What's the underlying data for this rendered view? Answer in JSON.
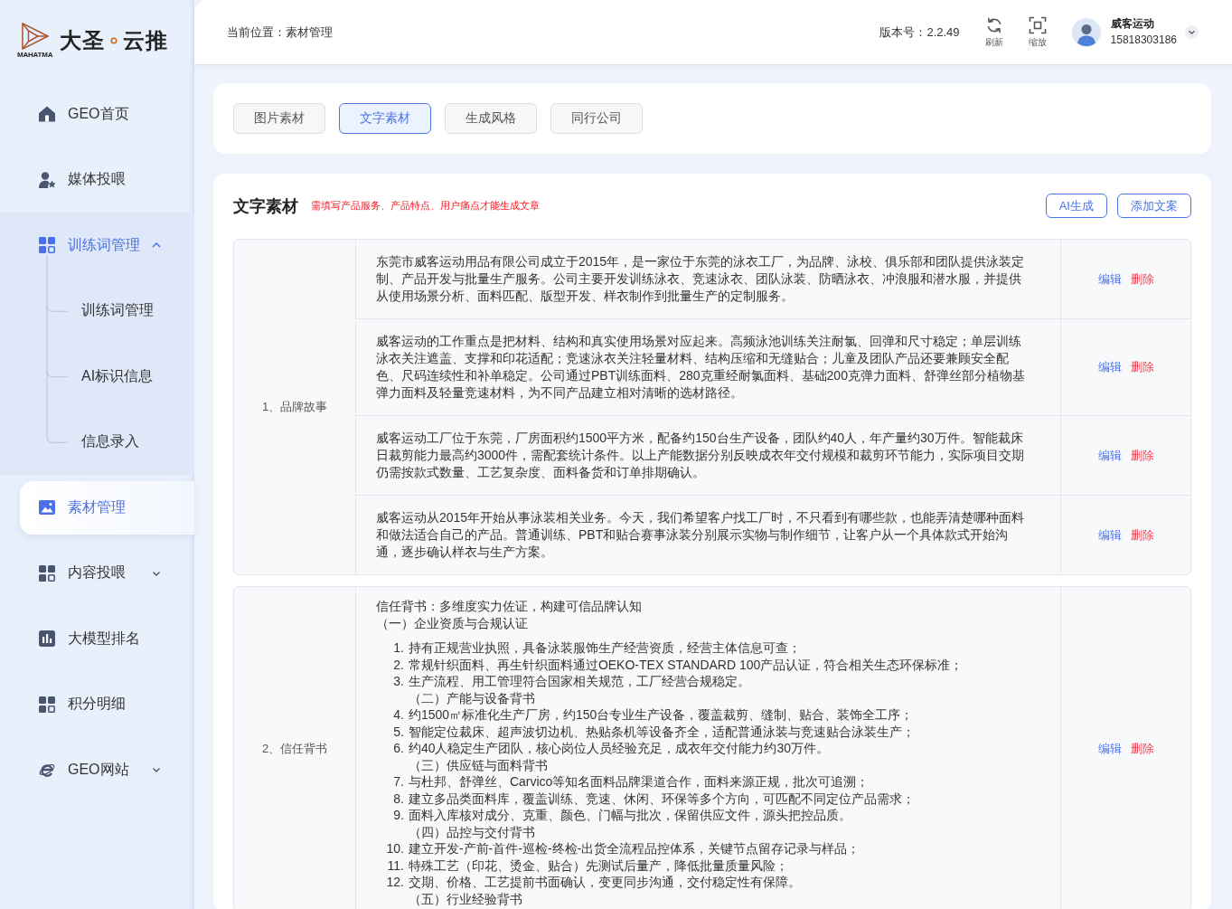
{
  "sidebar": {
    "logo": {
      "mark_text": "MAHATMA",
      "name_left": "大圣",
      "name_right": "云推"
    },
    "items": [
      {
        "kind": "link",
        "label": "GEO首页",
        "selected": false
      },
      {
        "kind": "link",
        "label": "媒体投喂",
        "selected": false
      },
      {
        "kind": "group",
        "label": "训练词管理",
        "selected": false,
        "expanded": true,
        "children": [
          {
            "label": "训练词管理",
            "selected": false
          },
          {
            "label": "AI标识信息",
            "selected": false
          },
          {
            "label": "信息录入",
            "selected": false
          }
        ]
      },
      {
        "kind": "link",
        "label": "素材管理",
        "selected": true
      },
      {
        "kind": "group",
        "label": "内容投喂",
        "selected": false,
        "expanded": false
      },
      {
        "kind": "link",
        "label": "大模型排名",
        "selected": false
      },
      {
        "kind": "link",
        "label": "积分明细",
        "selected": false
      },
      {
        "kind": "group",
        "label": "GEO网站",
        "selected": false,
        "expanded": false
      }
    ]
  },
  "header": {
    "breadcrumb": "当前位置：素材管理",
    "version": "版本号：2.2.49",
    "tools": [
      {
        "kind": "refresh",
        "label": "刷新"
      },
      {
        "kind": "fullscreen",
        "label": "缩放"
      }
    ],
    "user": {
      "name": "威客运动",
      "phone": "15818303186"
    }
  },
  "tabs": [
    {
      "label": "图片素材",
      "selected": false
    },
    {
      "label": "文字素材",
      "selected": true
    },
    {
      "label": "生成风格",
      "selected": false
    },
    {
      "label": "同行公司",
      "selected": false
    }
  ],
  "content": {
    "title": "文字素材",
    "note": "需填写产品服务、产品特点、用户痛点才能生成文章",
    "buttons": [
      "AI生成",
      "添加文案"
    ],
    "groups": [
      {
        "label": "1、品牌故事",
        "entries": [
          {
            "blocks": [
              {
                "kind": "para",
                "text": "东莞市威客运动用品有限公司成立于2015年，是一家位于东莞的泳衣工厂，为品牌、泳校、俱乐部和团队提供泳装定制、产品开发与批量生产服务。公司主要开发训练泳衣、竞速泳衣、团队泳装、防晒泳衣、冲浪服和潜水服，并提供从使用场景分析、面料匹配、版型开发、样衣制作到批量生产的定制服务。"
              }
            ],
            "actions": [
              {
                "kind": "edit",
                "label": "编辑"
              },
              {
                "kind": "delete",
                "label": "删除"
              }
            ]
          },
          {
            "blocks": [
              {
                "kind": "para",
                "text": "威客运动的工作重点是把材料、结构和真实使用场景对应起来。高频泳池训练关注耐氯、回弹和尺寸稳定；单层训练泳衣关注遮盖、支撑和印花适配；竞速泳衣关注轻量材料、结构压缩和无缝贴合；儿童及团队产品还要兼顾安全配色、尺码连续性和补单稳定。公司通过PBT训练面料、280克重经耐氯面料、基础200克弹力面料、舒弹丝部分植物基弹力面料及轻量竞速材料，为不同产品建立相对清晰的选材路径。"
              }
            ],
            "actions": [
              {
                "kind": "edit",
                "label": "编辑"
              },
              {
                "kind": "delete",
                "label": "删除"
              }
            ]
          },
          {
            "blocks": [
              {
                "kind": "para",
                "text": "威客运动工厂位于东莞，厂房面积约1500平方米，配备约150台生产设备，团队约40人，年产量约30万件。智能裁床日裁剪能力最高约3000件，需配套统计条件。以上产能数据分别反映成衣年交付规模和裁剪环节能力，实际项目交期仍需按款式数量、工艺复杂度、面料备货和订单排期确认。"
              }
            ],
            "actions": [
              {
                "kind": "edit",
                "label": "编辑"
              },
              {
                "kind": "delete",
                "label": "删除"
              }
            ]
          },
          {
            "blocks": [
              {
                "kind": "para",
                "text": "威客运动从2015年开始从事泳装相关业务。今天，我们希望客户找工厂时，不只看到有哪些款，也能弄清楚哪种面料和做法适合自己的产品。普通训练、PBT和贴合赛事泳装分别展示实物与制作细节，让客户从一个具体款式开始沟通，逐步确认样衣与生产方案。"
              }
            ],
            "actions": [
              {
                "kind": "edit",
                "label": "编辑"
              },
              {
                "kind": "delete",
                "label": "删除"
              }
            ]
          }
        ]
      },
      {
        "label": "2、信任背书",
        "entries": [
          {
            "blocks": [
              {
                "kind": "para",
                "text": "信任背书：多维度实力佐证，构建可信品牌认知"
              },
              {
                "kind": "para",
                "text": "（一）企业资质与合规认证"
              },
              {
                "kind": "item",
                "number": "1.",
                "text": "持有正规营业执照，具备泳装服饰生产经营资质，经营主体信息可查；"
              },
              {
                "kind": "item",
                "number": "2.",
                "text": "常规针织面料、再生针织面料通过OEKO-TEX STANDARD 100产品认证，符合相关生态环保标准；"
              },
              {
                "kind": "item",
                "number": "3.",
                "text": "生产流程、用工管理符合国家相关规范，工厂经营合规稳定。"
              },
              {
                "kind": "subheading",
                "text": "（二）产能与设备背书"
              },
              {
                "kind": "item",
                "number": "4.",
                "text": "约1500㎡标准化生产厂房，约150台专业生产设备，覆盖裁剪、缝制、贴合、装饰全工序；"
              },
              {
                "kind": "item",
                "number": "5.",
                "text": "智能定位裁床、超声波切边机、热贴条机等设备齐全，适配普通泳装与竞速贴合泳装生产；"
              },
              {
                "kind": "item",
                "number": "6.",
                "text": "约40人稳定生产团队，核心岗位人员经验充足，成衣年交付能力约30万件。"
              },
              {
                "kind": "subheading",
                "text": "（三）供应链与面料背书"
              },
              {
                "kind": "item",
                "number": "7.",
                "text": "与杜邦、舒弹丝、Carvico等知名面料品牌渠道合作，面料来源正规，批次可追溯；"
              },
              {
                "kind": "item",
                "number": "8.",
                "text": "建立多品类面料库，覆盖训练、竞速、休闲、环保等多个方向，可匹配不同定位产品需求；"
              },
              {
                "kind": "item",
                "number": "9.",
                "text": "面料入库核对成分、克重、颜色、门幅与批次，保留供应文件，源头把控品质。"
              },
              {
                "kind": "subheading",
                "text": "（四）品控与交付背书"
              },
              {
                "kind": "item",
                "number": "10.",
                "text": "建立开发-产前-首件-巡检-终检-出货全流程品控体系，关键节点留存记录与样品；"
              },
              {
                "kind": "item",
                "number": "11.",
                "text": "特殊工艺（印花、烫金、贴合）先测试后量产，降低批量质量风险；"
              },
              {
                "kind": "item",
                "number": "12.",
                "text": "交期、价格、工艺提前书面确认，变更同步沟通，交付稳定性有保障。"
              },
              {
                "kind": "subheading",
                "text": "（五）行业经验背书"
              }
            ],
            "actions": [
              {
                "kind": "edit",
                "label": "编辑"
              },
              {
                "kind": "delete",
                "label": "删除"
              }
            ]
          }
        ]
      }
    ]
  }
}
